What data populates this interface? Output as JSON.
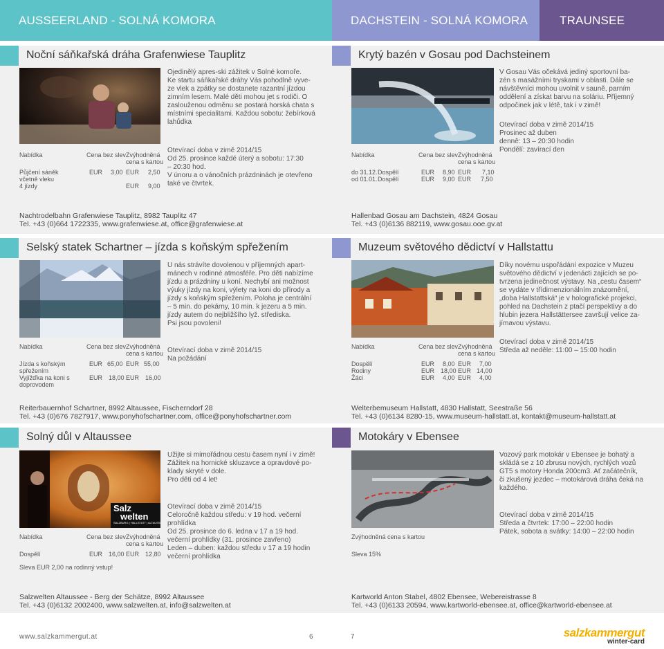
{
  "header": {
    "left": "AUSSEERLAND - SOLNÁ KOMORA",
    "middle": "DACHSTEIN - SOLNÁ KOMORA",
    "right": "TRAUNSEE"
  },
  "colors": {
    "teal": "#5cc3c8",
    "lavender": "#8f97d0",
    "purple": "#6b5690",
    "panel": "#f0f0f0"
  },
  "s1": {
    "title": "Noční sáňkařská dráha Grafenwiese Tauplitz",
    "desc": [
      "Ojedinělý apres-ski zážitek v Solné komoře.",
      "Ke startu sáňkařské dráhy Vás pohodlně vyve-",
      "ze vlek a zpátky se dostanete razantní jízdou",
      "zimním lesem. Malé děti mohou jet s rodiči. O",
      "zaslouženou odměnu se postará horská chata s",
      "místními specialitami. Každou sobotu: žebírková",
      "lahůdka"
    ],
    "hours": [
      "Otevírací doba v zimě 2014/15",
      "Od 25. prosince   každé úterý a sobotu: 17:30",
      "– 20:30 hod.",
      "V únoru a o vánočních prázdninách je otevřeno",
      "také ve čtvrtek."
    ],
    "th": {
      "c1": "Nabídka",
      "c2": "Cena bez slev",
      "c3": "Zvýhodněná",
      "c3b": "cena s kartou"
    },
    "rows": [
      {
        "label": [
          "Půjčení sáněk",
          "včetně vleku",
          "4 jízdy"
        ],
        "cur1": "EUR",
        "v1": "3,00",
        "cur2": "EUR",
        "v2": "2,50",
        "cur3": "EUR",
        "v3": "9,00"
      }
    ],
    "addr1": "Nachtrodelbahn Grafenwiese Tauplitz, 8982 Tauplitz 47",
    "addr2": "Tel. +43 (0)664 1722335, www.grafenwiese.at, office@grafenwiese.at"
  },
  "s2": {
    "title": "Selský statek Schartner – jízda s koňským spřežením",
    "desc": [
      "U nás strávíte dovolenou v příjemných apart-",
      "mánech v rodinné atmosféře. Pro děti nabízíme",
      "jízdu a prázdniny u koní. Nechybí ani  možnost",
      "výuky jízdy na koni, výlety na koni do přírody a",
      "jízdy s koňským spřežením. Poloha je centrální",
      "– 5 min. do pekárny, 10 min. k jezeru a 5 min.",
      "jízdy autem do nejbližšího lyž. střediska.",
      "Psi jsou povoleni!"
    ],
    "hours": [
      "Otevírací doba v zimě 2014/15",
      "Na požádání"
    ],
    "th": {
      "c1": "Nabídka",
      "c2": "Cena bez slev",
      "c3": "Zvýhodněná",
      "c3b": "cena s kartou"
    },
    "rows": [
      {
        "label": [
          "Jízda s koňským",
          "spřežením"
        ],
        "cur1": "EUR",
        "v1": "65,00",
        "cur2": "EUR",
        "v2": "55,00"
      },
      {
        "label": [
          "Vyjížďka na koni s",
          "doprovodem"
        ],
        "cur1": "EUR",
        "v1": "18,00",
        "cur2": "EUR",
        "v2": "16,00"
      }
    ],
    "addr1": "Reiterbauernhof Schartner, 8992 Altaussee, Fischerndorf 28",
    "addr2": "Tel. +43 (0)676 7827917, www.ponyhofschartner.com, office@ponyhofschartner.com"
  },
  "s3": {
    "title": "Solný důl v Altaussee",
    "desc": [
      "Užijte si mimořádnou cestu časem nyní i v zimě!",
      "Zážitek na hornické skluzavce a opravdové po-",
      "klady skryté v dole.",
      "Pro děti od 4 let!"
    ],
    "hours": [
      "Otevírací doba v zimě 2014/15",
      "Celoročně každou středu: v 19 hod. večerní",
      "prohlídka",
      "Od 25. prosince do 6. ledna v 17 a 19 hod.",
      "večerní prohlídky (31. prosince zavřeno)",
      "Leden – duben: každou středu v 17 a 19 hodin",
      "večerní prohlídka"
    ],
    "th": {
      "c1": "Nabídka",
      "c2": "Cena bez slev",
      "c3": "Zvýhodněná",
      "c3b": "cena s kartou"
    },
    "rows": [
      {
        "label": [
          "Dospělí"
        ],
        "cur1": "EUR",
        "v1": "16,00",
        "cur2": "EUR",
        "v2": "12,80"
      }
    ],
    "note": "Sleva EUR 2,00 na rodinný vstup!",
    "logo1": "Salz",
    "logo2": "welten",
    "logo3": "SALZBURG | HALLSTATT | ALTAUSSEE",
    "addr1": "Salzwelten Altaussee - Berg der Schätze, 8992 Altaussee",
    "addr2": "Tel. +43 (0)6132 2002400, www.salzwelten.at, info@salzwelten.at"
  },
  "s4": {
    "title": "Krytý bazén v Gosau pod Dachsteinem",
    "desc": [
      "V Gosau Vás očekává jediný sportovní ba-",
      "zén s masážními tryskami v oblasti. Dále se",
      "návštěvníci mohou uvolnit v sauně, parním",
      "oddělení a získat barvu na soláriu. Příjemný",
      "odpočinek jak v létě, tak i v zimě!"
    ],
    "hours": [
      "Otevírací doba v zimě 2014/15",
      "Prosinec až duben",
      "denně: 13 – 20:30 hodin",
      "Pondělí: zavírací den"
    ],
    "th": {
      "c1": "Nabídka",
      "c2": "Cena bez slev",
      "c3": "Zvýhodněná",
      "c3b": "cena s kartou"
    },
    "rows": [
      {
        "d": "do 31.12.",
        "label": "Dospělí",
        "cur1": "EUR",
        "v1": "8,90",
        "cur2": "EUR",
        "v2": "7,10"
      },
      {
        "d": "od 01.01.",
        "label": "Dospělí",
        "cur1": "EUR",
        "v1": "9,00",
        "cur2": "EUR",
        "v2": "7,50"
      }
    ],
    "addr1": "Hallenbad Gosau am Dachstein, 4824 Gosau",
    "addr2": "Tel. +43 (0)6136 882119, www.gosau.ooe.gv.at"
  },
  "s5": {
    "title": "Muzeum světového dědictví v Hallstattu",
    "desc": [
      "Díky novému uspořádání expozice v Muzeu",
      "světového dědictví v jedenácti zajících se po-",
      "tvrzena jedinečnost výstavy. Na „cestu časem“",
      "se vydáte v třídimenzionálním znázornění,",
      "„doba Hallstattská“ je v holografické projekci,",
      "pohled na Dachstein z ptačí perspektivy a do",
      "hlubin jezera Hallstättersee završují velice za-",
      "jímavou výstavu."
    ],
    "hours": [
      "Otevírací doba v zimě 2014/15",
      "Středa až neděle: 11:00 – 15:00 hodin"
    ],
    "th": {
      "c1": "Nabídka",
      "c2": "Cena bez slev",
      "c3": "Zvýhodněná",
      "c3b": "cena s kartou"
    },
    "rows": [
      {
        "label": "Dospělí",
        "cur1": "EUR",
        "v1": "8,00",
        "cur2": "EUR",
        "v2": "7,00"
      },
      {
        "label": "Rodiny",
        "cur1": "EUR",
        "v1": "18,00",
        "cur2": "EUR",
        "v2": "14,00"
      },
      {
        "label": "Žáci",
        "cur1": "EUR",
        "v1": "4,00",
        "cur2": "EUR",
        "v2": "4,00"
      }
    ],
    "addr1": "Welterbemuseum Hallstatt, 4830 Hallstatt, Seestraße 56",
    "addr2": "Tel. +43 (0)6134 8280-15, www.museum-hallstatt.at, kontakt@museum-hallstatt.at"
  },
  "s6": {
    "title": "Motokáry v Ebensee",
    "desc": [
      "Vozový park motokár v Ebensee je bohatý a",
      "skládá se z 10 zbrusu nových, rychlých vozů",
      "GT5 s motory Honda 200cm3. Ať začátečník,",
      "či zkušený jezdec – motokárová dráha čeká na",
      "každého."
    ],
    "hours": [
      "Otevírací doba v zimě 2014/15",
      "Středa a čtvrtek: 17:00 – 22:00 hodin",
      "Pátek, sobota a svátky: 14:00 – 22:00 hodin"
    ],
    "card": "Zvýhodněná cena s kartou",
    "discount": "Sleva 15%",
    "addr1": "Kartworld Anton Stabel, 4802 Ebensee, Webereistrasse 8",
    "addr2": "Tel. +43 (0)6133 20594, www.kartworld-ebensee.at, office@kartworld-ebensee.at"
  },
  "footer": {
    "url": "www.salzkammergut.at",
    "page_left": "6",
    "page_right": "7",
    "logo_main": "salzkammergut",
    "logo_sub": "winter-card"
  }
}
